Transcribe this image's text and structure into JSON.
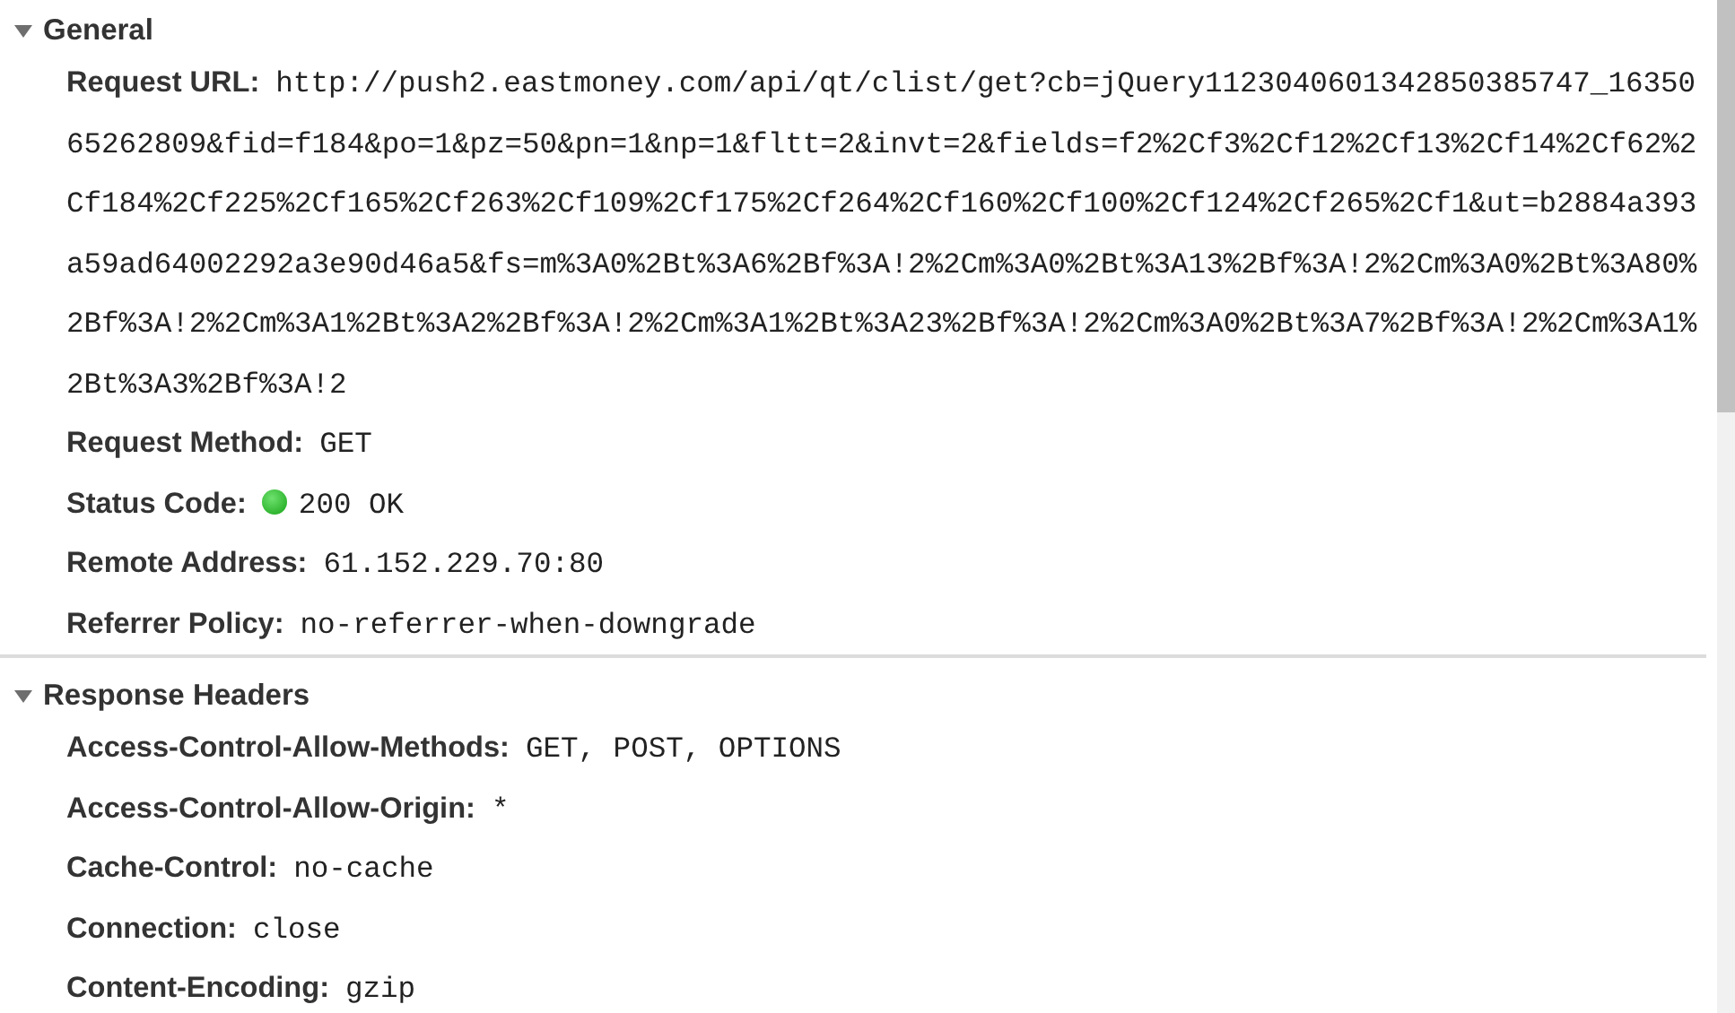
{
  "sections": [
    {
      "title": "General",
      "expanded": true,
      "rows": [
        {
          "kind": "text",
          "name": "Request URL:",
          "value": "http://push2.eastmoney.com/api/qt/clist/get?cb=jQuery1123040601342850385747_1635065262809&fid=f184&po=1&pz=50&pn=1&np=1&fltt=2&invt=2&fields=f2%2Cf3%2Cf12%2Cf13%2Cf14%2Cf62%2Cf184%2Cf225%2Cf165%2Cf263%2Cf109%2Cf175%2Cf264%2Cf160%2Cf100%2Cf124%2Cf265%2Cf1&ut=b2884a393a59ad64002292a3e90d46a5&fs=m%3A0%2Bt%3A6%2Bf%3A!2%2Cm%3A0%2Bt%3A13%2Bf%3A!2%2Cm%3A0%2Bt%3A80%2Bf%3A!2%2Cm%3A1%2Bt%3A2%2Bf%3A!2%2Cm%3A1%2Bt%3A23%2Bf%3A!2%2Cm%3A0%2Bt%3A7%2Bf%3A!2%2Cm%3A1%2Bt%3A3%2Bf%3A!2"
        },
        {
          "kind": "text",
          "name": "Request Method:",
          "value": "GET"
        },
        {
          "kind": "status",
          "name": "Status Code:",
          "value": "200 OK"
        },
        {
          "kind": "text",
          "name": "Remote Address:",
          "value": "61.152.229.70:80"
        },
        {
          "kind": "text",
          "name": "Referrer Policy:",
          "value": "no-referrer-when-downgrade"
        }
      ]
    },
    {
      "title": "Response Headers",
      "expanded": true,
      "rows": [
        {
          "kind": "text",
          "name": "Access-Control-Allow-Methods:",
          "value": "GET, POST, OPTIONS"
        },
        {
          "kind": "text",
          "name": "Access-Control-Allow-Origin:",
          "value": "*"
        },
        {
          "kind": "text",
          "name": "Cache-Control:",
          "value": "no-cache"
        },
        {
          "kind": "text",
          "name": "Connection:",
          "value": "close"
        },
        {
          "kind": "text",
          "name": "Content-Encoding:",
          "value": "gzip"
        }
      ]
    }
  ]
}
